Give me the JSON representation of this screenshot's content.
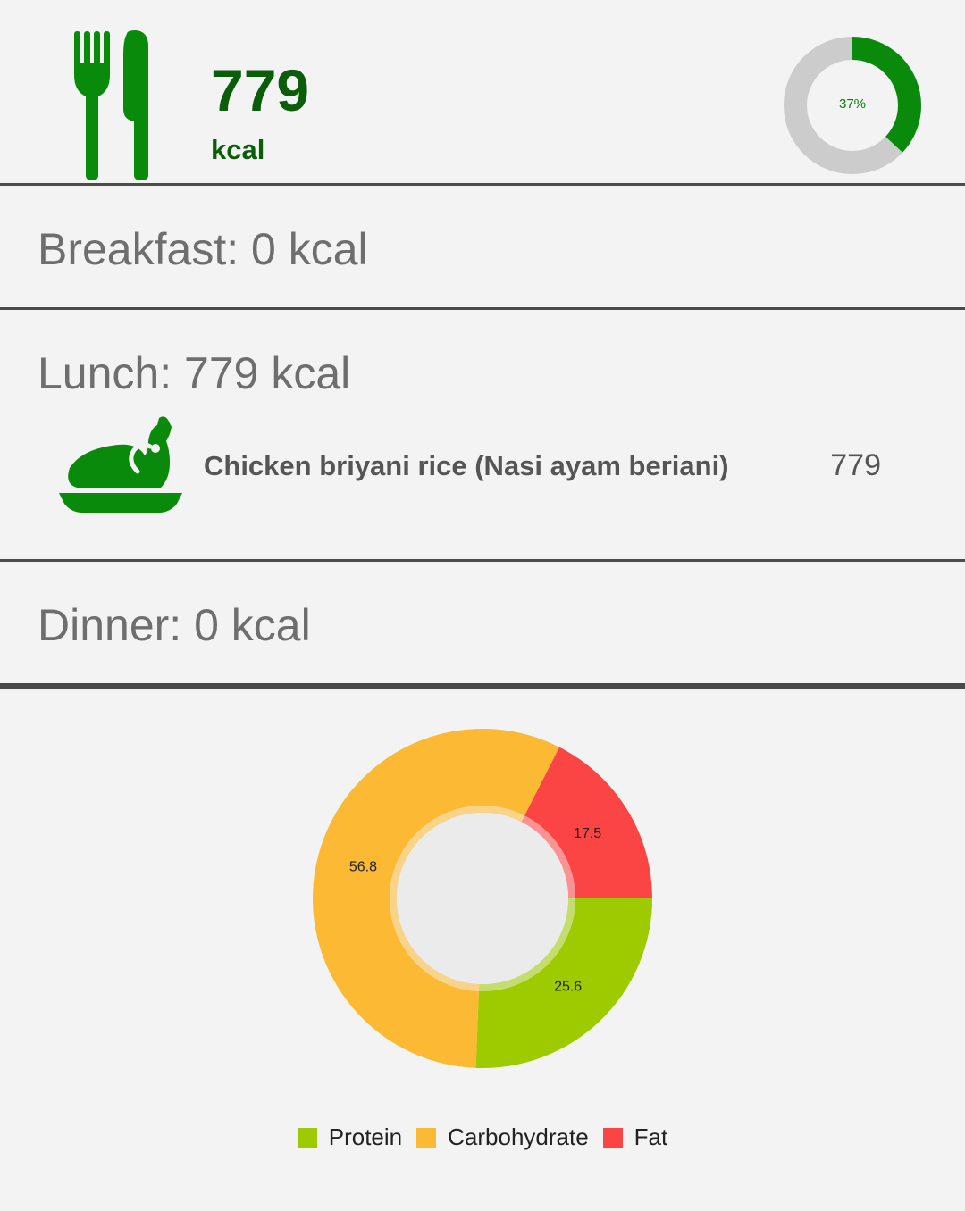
{
  "header": {
    "total_kcal": "779",
    "unit": "kcal",
    "goal_progress": {
      "label": "37%",
      "fraction": 0.37
    },
    "colors": {
      "accent": "#0a8a0a",
      "track": "#cccccc"
    },
    "icon": "fork-knife-icon"
  },
  "meals": {
    "breakfast": {
      "title": "Breakfast: 0 kcal"
    },
    "lunch": {
      "title": "Lunch: 779 kcal",
      "items": [
        {
          "icon": "roast-chicken-icon",
          "name": "Chicken briyani rice (Nasi ayam beriani)",
          "kcal": "779"
        }
      ]
    },
    "dinner": {
      "title": "Dinner: 0 kcal"
    }
  },
  "chart_data": {
    "type": "pie",
    "categories": [
      "Protein",
      "Carbohydrate",
      "Fat"
    ],
    "values": [
      25.6,
      56.8,
      17.5
    ],
    "value_labels": [
      "25.6",
      "56.8",
      "17.5"
    ],
    "colors": [
      "#9dcb00",
      "#fbb934",
      "#fb4444"
    ],
    "legend": {
      "placement": "bottom-center"
    }
  }
}
